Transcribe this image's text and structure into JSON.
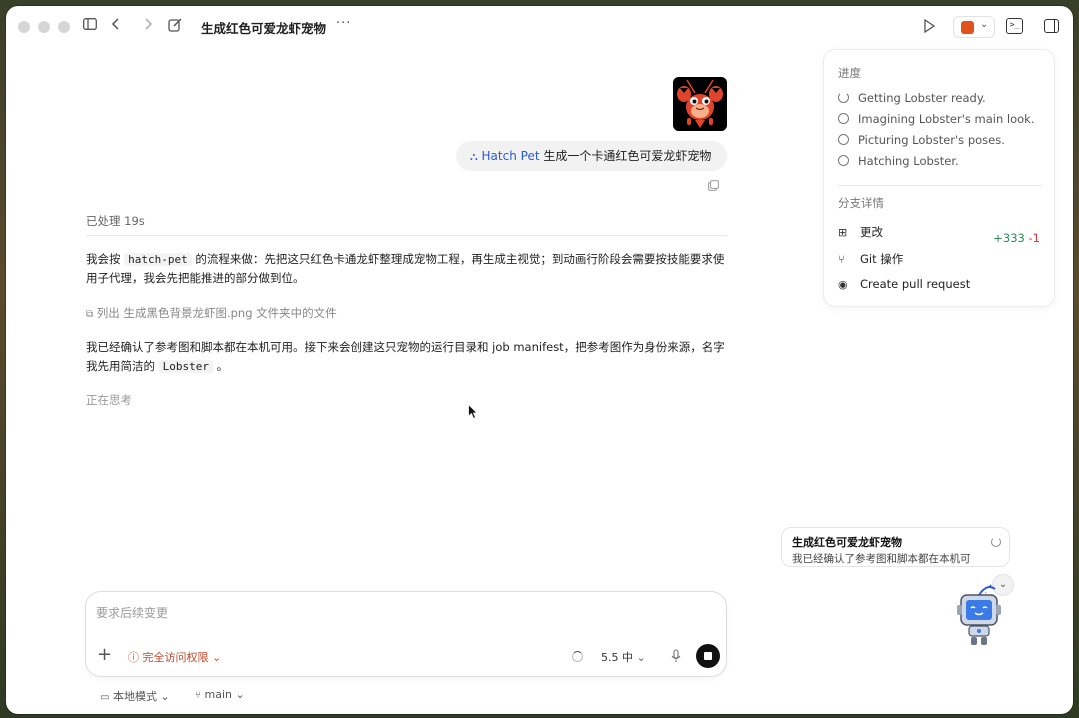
{
  "window": {
    "title": "生成红色可爱龙虾宠物",
    "more": "···"
  },
  "chat": {
    "user_message": {
      "tag": "Hatch Pet",
      "text": "生成一个卡通红色可爱龙虾宠物"
    },
    "processed": "已处理 19s",
    "para1_parts": [
      "我会按 ",
      "hatch-pet",
      " 的流程来做：先把这只红色卡通龙虾整理成宠物工程，再生成主视觉；到动画行阶段会需要按技能要求使用子代理，我会先把能推进的部分做到位。"
    ],
    "tool_line": "列出 生成黑色背景龙虾图.png 文件夹中的文件",
    "para2_parts": [
      "我已经确认了参考图和脚本都在本机可用。接下来会创建这只宠物的运行目录和 job manifest，把参考图作为身份来源，名字我先用简洁的 ",
      "Lobster",
      " 。"
    ],
    "thinking": "正在思考"
  },
  "composer": {
    "placeholder": "要求后续变更",
    "permission": "完全访问权限",
    "model": "5.5 中"
  },
  "bottom_bar": {
    "mode": "本地模式",
    "branch": "main"
  },
  "progress_panel": {
    "section_title": "进度",
    "steps": [
      "Getting Lobster ready.",
      "Imagining Lobster's main look.",
      "Picturing Lobster's poses.",
      "Hatching Lobster."
    ],
    "branch_title": "分支详情",
    "changes_label": "更改",
    "additions": "+333",
    "deletions": "-1",
    "git_label": "Git 操作",
    "pr_label": "Create pull request"
  },
  "toast": {
    "title": "生成红色可爱龙虾宠物",
    "text": "我已经确认了参考图和脚本都在本机可"
  },
  "colors": {
    "accent_blue": "#2a5bd7",
    "warning_red": "#c0492b",
    "additions_green": "#2e8b57",
    "deletions_red": "#d23c3c"
  }
}
